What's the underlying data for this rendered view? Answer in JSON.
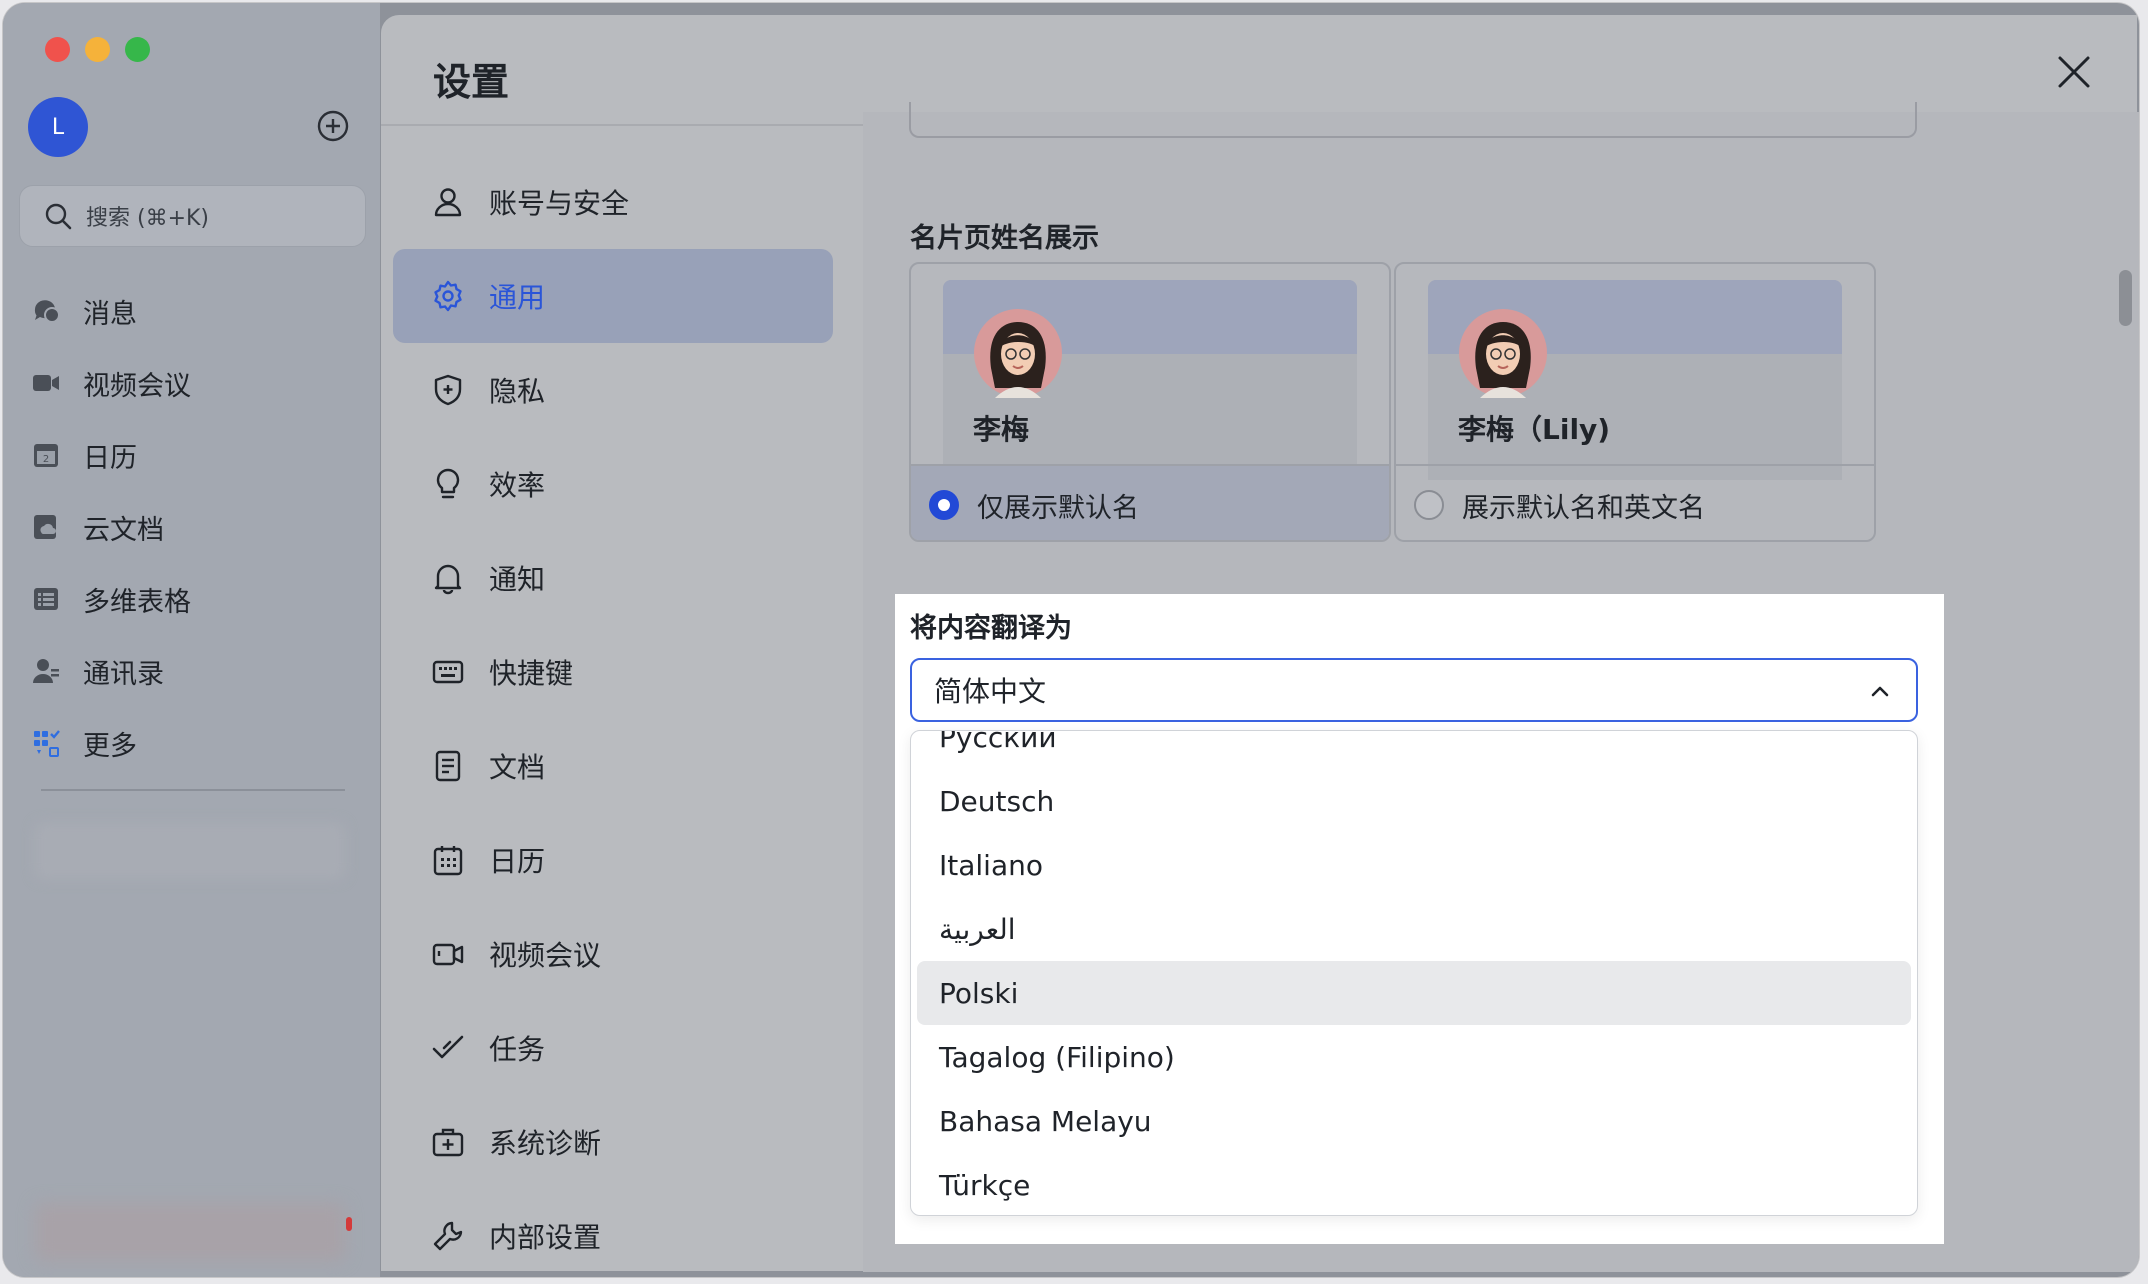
{
  "sidebar": {
    "avatar_initial": "L",
    "search_placeholder": "搜索 (⌘+K)",
    "items": [
      {
        "label": "消息",
        "icon": "chat-icon"
      },
      {
        "label": "视频会议",
        "icon": "video-camera-icon"
      },
      {
        "label": "日历",
        "icon": "calendar-icon"
      },
      {
        "label": "云文档",
        "icon": "cloud-doc-icon"
      },
      {
        "label": "多维表格",
        "icon": "table-icon"
      },
      {
        "label": "通讯录",
        "icon": "contacts-icon"
      },
      {
        "label": "更多",
        "icon": "more-apps-icon"
      }
    ]
  },
  "dialog": {
    "title": "设置",
    "menu": [
      {
        "label": "账号与安全",
        "icon": "user-icon"
      },
      {
        "label": "通用",
        "icon": "gear-icon",
        "active": true
      },
      {
        "label": "隐私",
        "icon": "shield-icon"
      },
      {
        "label": "效率",
        "icon": "lightbulb-icon"
      },
      {
        "label": "通知",
        "icon": "bell-icon"
      },
      {
        "label": "快捷键",
        "icon": "keyboard-icon"
      },
      {
        "label": "文档",
        "icon": "document-icon"
      },
      {
        "label": "日历",
        "icon": "calendar-icon"
      },
      {
        "label": "视频会议",
        "icon": "video-camera-icon"
      },
      {
        "label": "任务",
        "icon": "task-check-icon"
      },
      {
        "label": "系统诊断",
        "icon": "medical-kit-icon"
      },
      {
        "label": "内部设置",
        "icon": "wrench-icon"
      }
    ]
  },
  "content": {
    "name_display": {
      "title": "名片页姓名展示",
      "options": [
        {
          "card_name": "李梅",
          "label": "仅展示默认名",
          "selected": true
        },
        {
          "card_name": "李梅（Lily)",
          "label": "展示默认名和英文名",
          "selected": false
        }
      ]
    },
    "translate": {
      "title": "将内容翻译为",
      "selected": "简体中文",
      "options": [
        "Русский",
        "Deutsch",
        "Italiano",
        "العربية",
        "Polski",
        "Tagalog (Filipino)",
        "Bahasa Melayu",
        "Türkçe"
      ],
      "hovered_option": "Polski"
    }
  },
  "colors": {
    "accent": "#2249d6",
    "active_menu_bg": "#98a1b8",
    "overlay_bg": "#b9bbbf"
  }
}
